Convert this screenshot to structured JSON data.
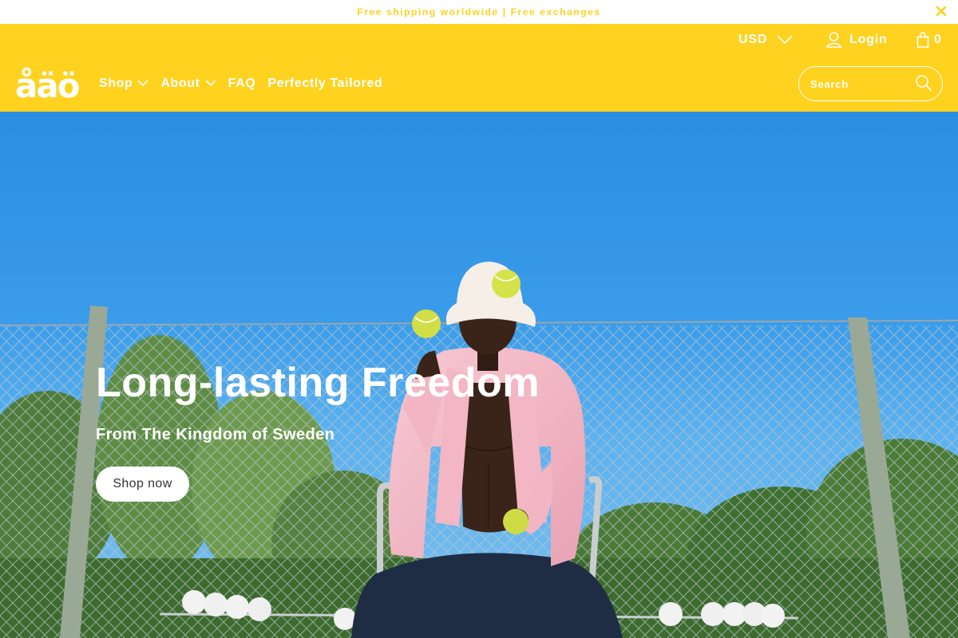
{
  "announcement": {
    "text": "Free shipping worldwide | Free exchanges",
    "close_icon": "close-icon"
  },
  "topbar": {
    "currency": "USD",
    "login_label": "Login",
    "cart_count": "0",
    "icons": [
      "chevron-down-icon",
      "user-icon",
      "bag-icon"
    ]
  },
  "header": {
    "logo_text": "åäö",
    "nav": [
      {
        "label": "Shop",
        "has_dropdown": true
      },
      {
        "label": "About",
        "has_dropdown": true
      },
      {
        "label": "FAQ",
        "has_dropdown": false
      },
      {
        "label": "Perfectly Tailored",
        "has_dropdown": false
      }
    ],
    "search": {
      "placeholder": "Search",
      "icon": "search-icon"
    }
  },
  "hero": {
    "title": "Long-lasting Freedom",
    "subtitle": "From The Kingdom of Sweden",
    "button_label": "Shop now"
  },
  "colors": {
    "brand_yellow": "#ffd21f",
    "sky_blue": "#3a9cea",
    "jacket_pink": "#f4b8c6",
    "ball_green": "#d6e24a"
  }
}
